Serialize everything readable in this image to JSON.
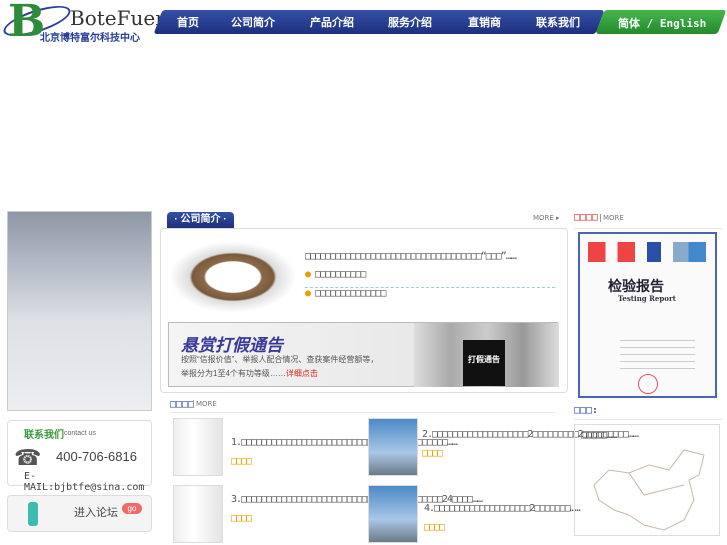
{
  "header": {
    "logo_letter": "B",
    "brand": "BoteFuer",
    "brand_cn": "北京博特富尔科技中心",
    "nav": [
      "首页",
      "公司简介",
      "产品介绍",
      "服务介绍",
      "直销商",
      "联系我们"
    ],
    "lang": "简体 / English"
  },
  "about": {
    "tab": "· 公司简介 ·",
    "more": "MORE ▸",
    "intro": "□□□□□□□□□□□□□□□□□□□□□□□□□□□□□□□□□□□“□□□”……",
    "items": [
      "□□□□□□□□□□",
      "□□□□□□□□□□□□□□"
    ]
  },
  "banner": {
    "title": "悬赏打假通告",
    "line1": "按照“信报价值”、举报人配合情况、查获案件经营额等，",
    "line2": "举报分为1至4个有功等级……",
    "link": "详细点击",
    "sign": "打假通告"
  },
  "news": {
    "title": "□□□□",
    "more": "MORE",
    "items": [
      {
        "text": "1.□□□□□□□□□□□□□□□□□□□□□□□□□□□□□□□□□□□□□□□□□……",
        "link": "□□□□"
      },
      {
        "text": "2.□□□□□□□□□□□□□□□□□□□2□□□□□□□□□2□□□□□□□□□……",
        "link": "□□□□"
      },
      {
        "text": "3.□□□□□□□□□□□□□□□□□□□□□□□□□□□□□□□□□□□□□□□□24□□□□……",
        "link": "□□□□"
      },
      {
        "text": "4.□□□□□□□□□□□□□□□□□□□2□□□□□□□……",
        "link": "□□□□"
      }
    ]
  },
  "contact": {
    "title": "联系我们",
    "sub": "contact us",
    "phone": "400-706-6816",
    "email": "E-MAIL:bjbtfe@sina.com"
  },
  "forum": {
    "label": "进入论坛",
    "go": "go"
  },
  "cert": {
    "title": "□□□□",
    "more": "MORE",
    "doc_title": "检验报告",
    "doc_sub": "Testing Report"
  },
  "map": {
    "title": "□□□:",
    "text": "□□□□□……"
  }
}
